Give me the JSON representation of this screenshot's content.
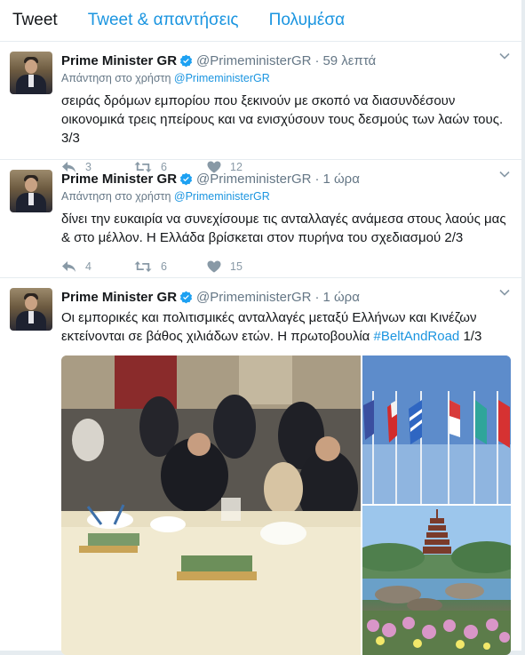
{
  "tabs": [
    {
      "label": "Tweet"
    },
    {
      "label": "Tweet & απαντήσεις"
    },
    {
      "label": "Πολυμέσα"
    }
  ],
  "tweets": [
    {
      "name": "Prime Minister GR",
      "handle": "@PrimeministerGR",
      "dot": "·",
      "time": "59 λεπτά",
      "reply_prefix": "Απάντηση στο χρήστη",
      "reply_handle": "@PrimeministerGR",
      "text": "σειράς δρόμων εμπορίου που ξεκινούν με σκοπό να διασυνδέσουν οικονομικά τρεις ηπείρους και να ενισχύσουν τους δεσμούς των λαών τους. 3/3",
      "replies": "3",
      "retweets": "6",
      "likes": "12"
    },
    {
      "name": "Prime Minister GR",
      "handle": "@PrimeministerGR",
      "dot": "·",
      "time": "1 ώρα",
      "reply_prefix": "Απάντηση στο χρήστη",
      "reply_handle": "@PrimeministerGR",
      "text": "δίνει την ευκαιρία να συνεχίσουμε τις ανταλλαγές ανάμεσα στους λαούς μας & στο μέλλον. Η Ελλάδα βρίσκεται στον πυρήνα του σχεδιασμού 2/3",
      "replies": "4",
      "retweets": "6",
      "likes": "15"
    },
    {
      "name": "Prime Minister GR",
      "handle": "@PrimeministerGR",
      "dot": "·",
      "time": "1 ώρα",
      "text": "Οι εμπορικές και πολιτισμικές ανταλλαγές μεταξύ Ελλήνων και Κινέζων εκτείνονται σε βάθος χιλιάδων ετών. Η πρωτοβουλία",
      "hashtag": "#BeltAndRoad",
      "text_suffix": " 1/3"
    }
  ],
  "colors": {
    "accent": "#1b95e0",
    "muted": "#657786",
    "icon": "#8899a6",
    "border": "#e6ecf0"
  },
  "icons": [
    "verified-badge-icon",
    "chevron-down-icon",
    "reply-icon",
    "retweet-icon",
    "heart-icon"
  ]
}
